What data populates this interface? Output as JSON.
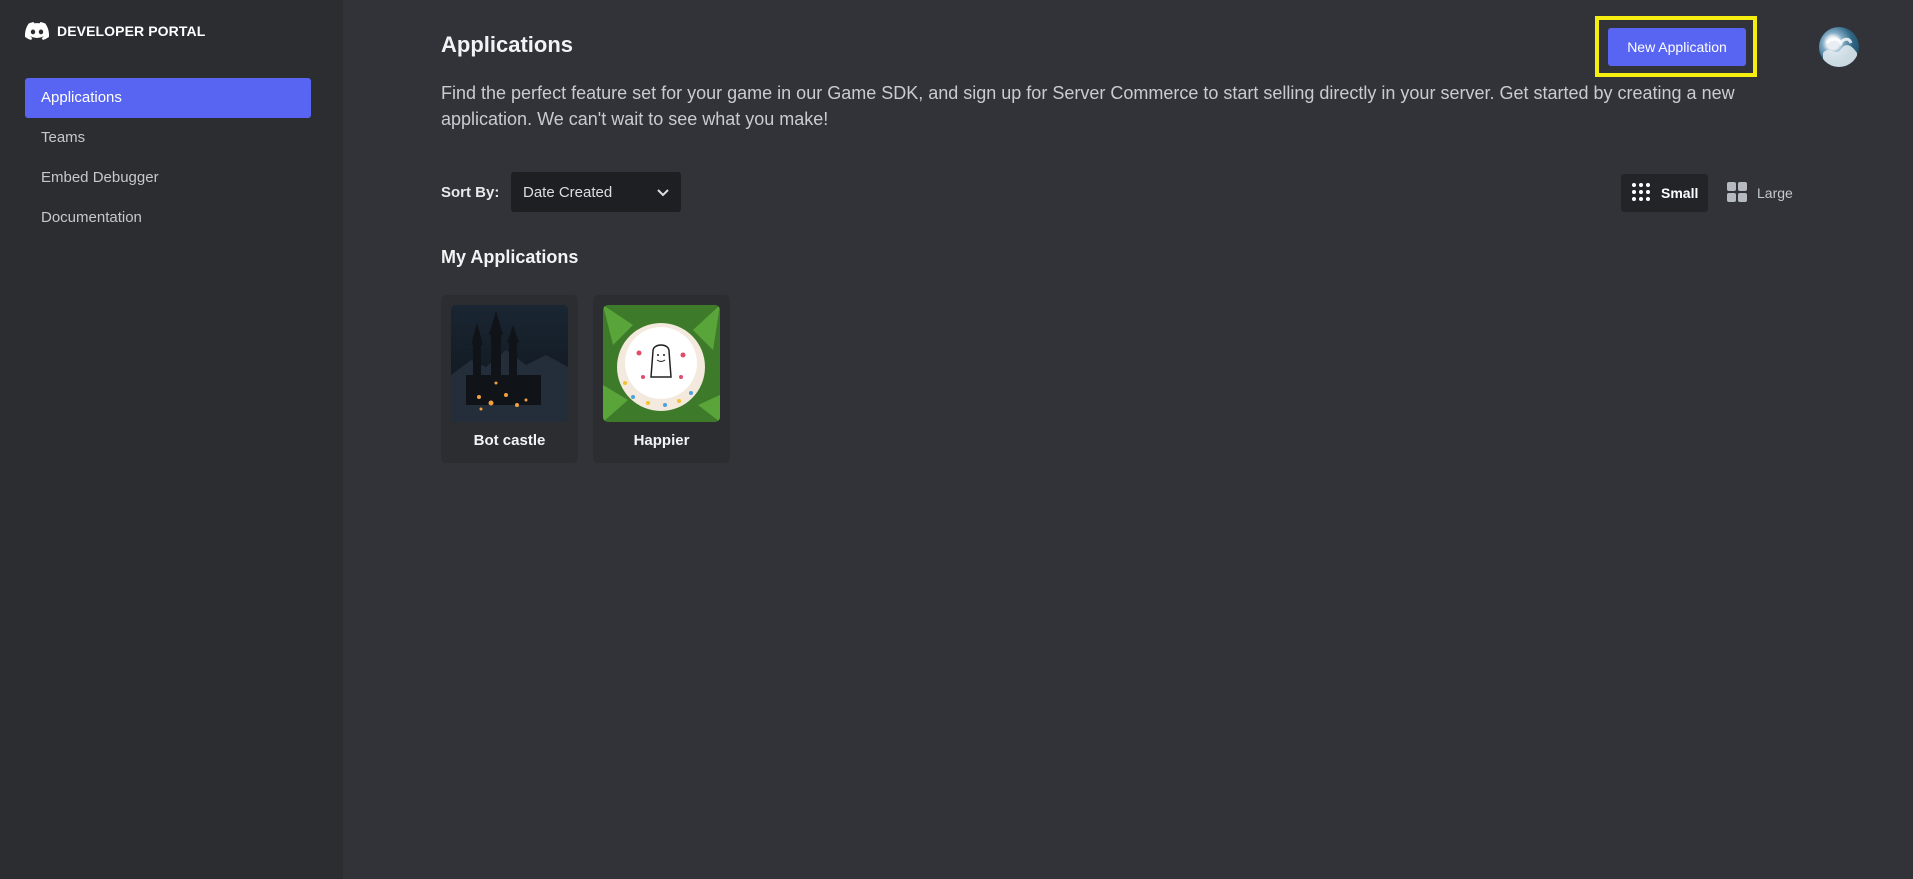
{
  "brand": {
    "title": "DEVELOPER PORTAL",
    "icon": "discord-logo-icon"
  },
  "sidebar": {
    "items": [
      {
        "label": "Applications",
        "active": true
      },
      {
        "label": "Teams",
        "active": false
      },
      {
        "label": "Embed Debugger",
        "active": false
      },
      {
        "label": "Documentation",
        "active": false
      }
    ]
  },
  "header": {
    "title": "Applications",
    "new_button_label": "New Application",
    "avatar": "user-avatar"
  },
  "intro": "Find the perfect feature set for your game in our Game SDK, and sign up for Server Commerce to start selling directly in your server. Get started by creating a new application. We can't wait to see what you make!",
  "sort": {
    "label": "Sort By:",
    "selected": "Date Created"
  },
  "view": {
    "small_label": "Small",
    "large_label": "Large",
    "selected": "Small"
  },
  "section_title": "My Applications",
  "applications": [
    {
      "name": "Bot castle",
      "thumbnail": "castle-night-image"
    },
    {
      "name": "Happier",
      "thumbnail": "cake-image"
    }
  ],
  "colors": {
    "accent": "#5865f2",
    "background": "#313338",
    "sidebar": "#2b2d31",
    "highlight": "#f5ee0f"
  }
}
